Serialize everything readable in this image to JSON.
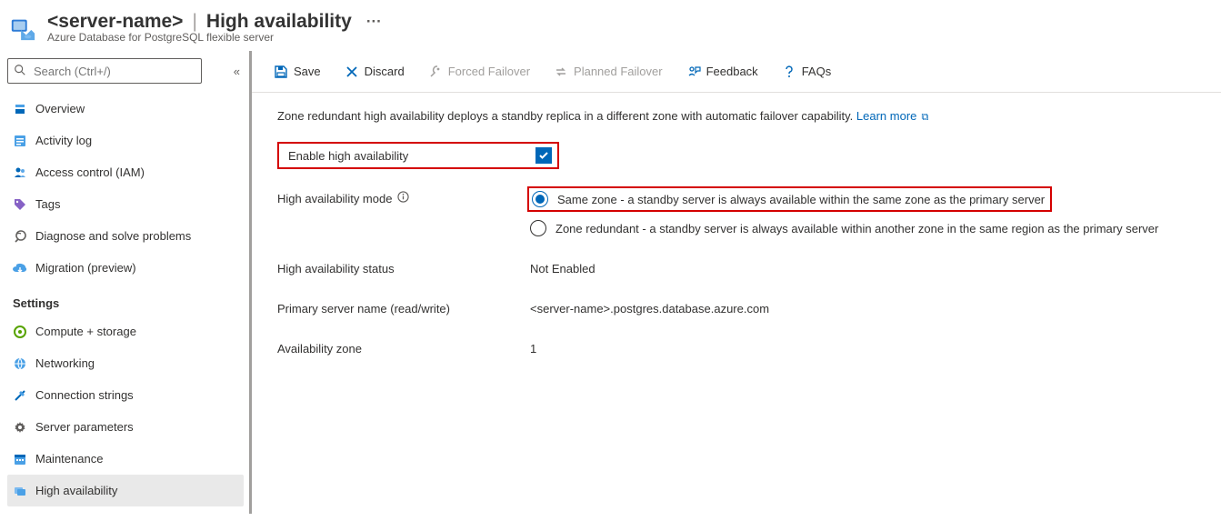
{
  "header": {
    "server_name": "<server-name>",
    "page_title": "High availability",
    "subtitle": "Azure Database for PostgreSQL flexible server"
  },
  "search": {
    "placeholder": "Search (Ctrl+/)"
  },
  "nav": {
    "items_top": [
      {
        "label": "Overview",
        "icon": "overview"
      },
      {
        "label": "Activity log",
        "icon": "activity"
      },
      {
        "label": "Access control (IAM)",
        "icon": "iam"
      },
      {
        "label": "Tags",
        "icon": "tags"
      },
      {
        "label": "Diagnose and solve problems",
        "icon": "diagnose"
      },
      {
        "label": "Migration (preview)",
        "icon": "migration"
      }
    ],
    "section_label": "Settings",
    "items_settings": [
      {
        "label": "Compute + storage",
        "icon": "compute"
      },
      {
        "label": "Networking",
        "icon": "network"
      },
      {
        "label": "Connection strings",
        "icon": "connstr"
      },
      {
        "label": "Server parameters",
        "icon": "params"
      },
      {
        "label": "Maintenance",
        "icon": "maint"
      },
      {
        "label": "High availability",
        "icon": "ha"
      }
    ]
  },
  "toolbar": {
    "save": "Save",
    "discard": "Discard",
    "forced_failover": "Forced Failover",
    "planned_failover": "Planned Failover",
    "feedback": "Feedback",
    "faqs": "FAQs"
  },
  "main": {
    "intro": "Zone redundant high availability deploys a standby replica in a different zone with automatic failover capability.",
    "learn_more": "Learn more",
    "enable_label": "Enable high availability",
    "enable_checked": true,
    "mode_label": "High availability mode",
    "mode_options": {
      "same_zone": "Same zone - a standby server is always available within the same zone as the primary server",
      "zone_redundant": "Zone redundant - a standby server is always available within another zone in the same region as the primary server"
    },
    "mode_selected": "same_zone",
    "status_label": "High availability status",
    "status_value": "Not Enabled",
    "primary_label": "Primary server name (read/write)",
    "primary_value": "<server-name>.postgres.database.azure.com",
    "az_label": "Availability zone",
    "az_value": "1"
  }
}
